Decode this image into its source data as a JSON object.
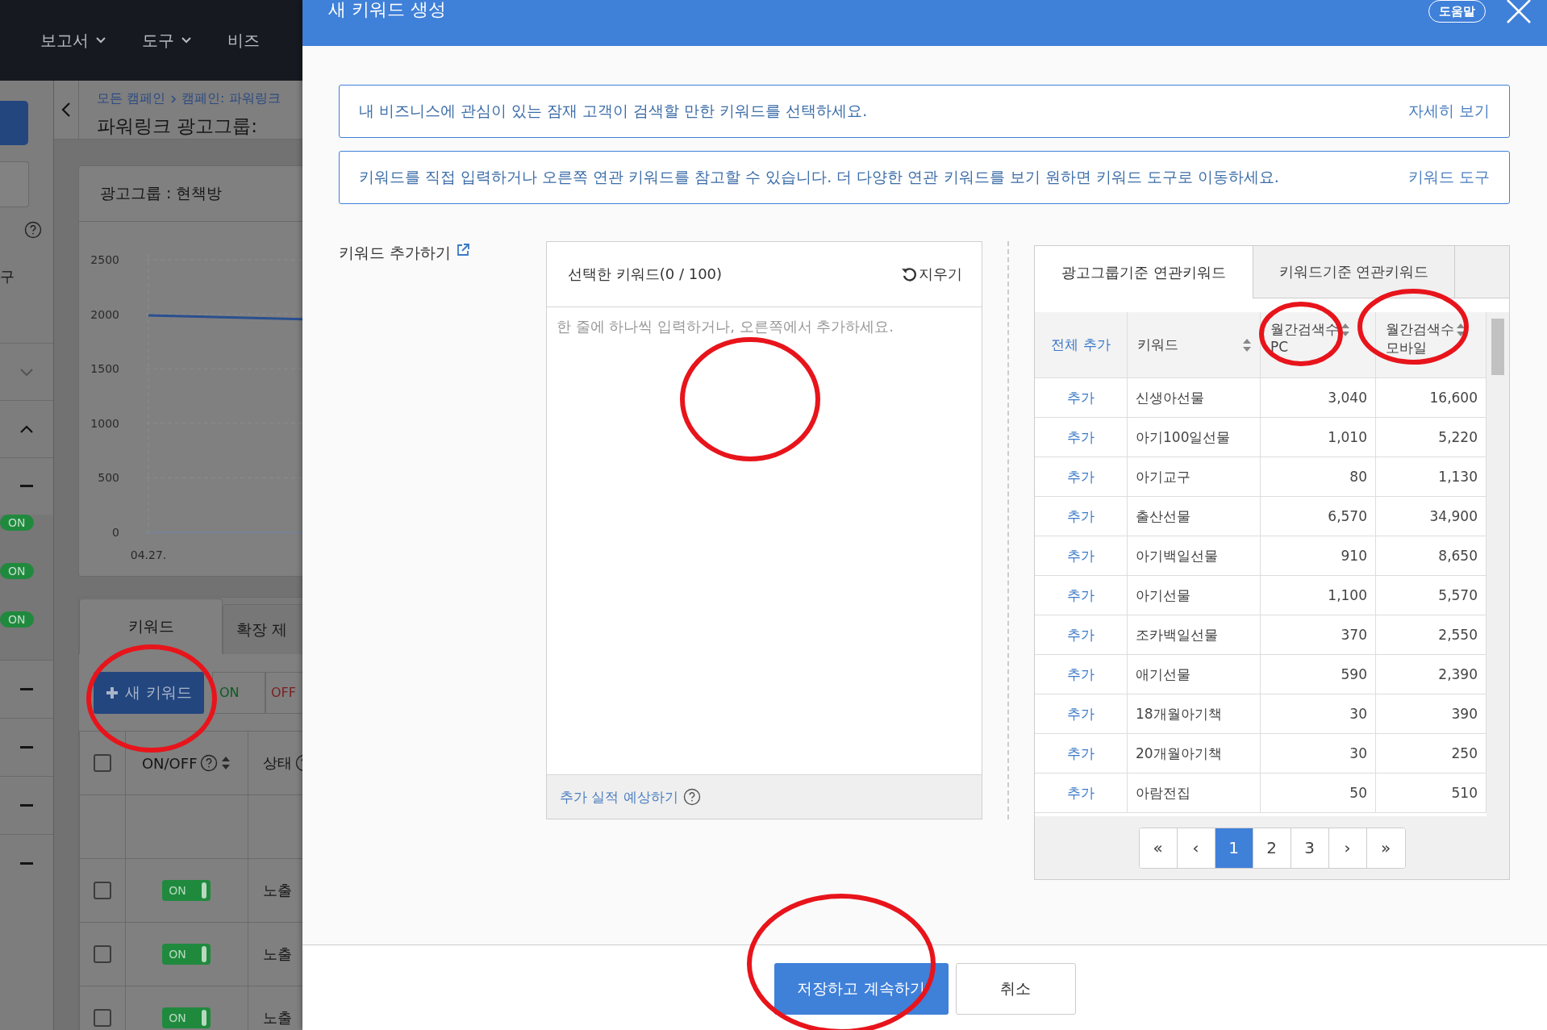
{
  "background": {
    "nav": [
      "보고서",
      "도구",
      "비즈"
    ],
    "sidebar": {
      "label": "구",
      "badges": [
        "ON",
        "ON",
        "ON"
      ]
    },
    "breadcrumb": [
      "모든 캠페인",
      "캠페인: 파워링크"
    ],
    "title": "파워링크 광고그룹:",
    "card": {
      "title": "광고그룹 : 현책방",
      "y_ticks": [
        "2500",
        "2000",
        "1500",
        "1000",
        "500",
        "0"
      ],
      "x_labels": [
        "04.27."
      ]
    },
    "tabs": [
      {
        "label": "키워드",
        "selected": true
      },
      {
        "label": "확장 제",
        "selected": false
      }
    ],
    "new_keyword_button": "새 키워드",
    "filter_buttons": [
      {
        "label": "ON",
        "color": "#0c5a22"
      },
      {
        "label": "OFF",
        "color": "#7a1e1e"
      }
    ],
    "table": {
      "columns": [
        "ON/OFF",
        "상태"
      ],
      "header_checked": false,
      "rows": [
        {
          "checked": false,
          "toggle": "ON",
          "on": true,
          "status": "노출"
        },
        {
          "checked": false,
          "toggle": "ON",
          "on": true,
          "status": "노출"
        },
        {
          "checked": false,
          "toggle": "ON",
          "on": true,
          "status": "노출"
        }
      ]
    }
  },
  "dialog": {
    "title": "새 키워드 생성",
    "help_button": "도움말",
    "notices": [
      {
        "text": "내 비즈니스에 관심이 있는 잠재 고객이 검색할 만한 키워드를 선택하세요.",
        "link": "자세히 보기"
      },
      {
        "text": "키워드를 직접 입력하거나 오른쪽 연관 키워드를 참고할 수 있습니다. 더 다양한 연관 키워드를 보기 원하면 키워드 도구로 이동하세요.",
        "link": "키워드 도구"
      }
    ],
    "add_keyword_label": "키워드 추가하기",
    "selected_panel": {
      "title": "선택한 키워드(0 / 100)",
      "clear_button": "지우기",
      "placeholder": "한 줄에 하나씩 입력하거나, 오른쪽에서 추가하세요.",
      "forecast_link": "추가 실적 예상하기"
    },
    "related": {
      "tabs": [
        {
          "label": "광고그룹기준 연관키워드",
          "selected": true
        },
        {
          "label": "키워드기준 연관키워드",
          "selected": false
        }
      ],
      "add_all": "전체 추가",
      "columns": [
        {
          "lines": [
            "키워드"
          ]
        },
        {
          "lines": [
            "월간검색수",
            "PC"
          ]
        },
        {
          "lines": [
            "월간검색수",
            "모바일"
          ]
        }
      ],
      "rows": [
        {
          "action": "추가",
          "keyword": "신생아선물",
          "pc": "3,040",
          "mobile": "16,600"
        },
        {
          "action": "추가",
          "keyword": "아기100일선물",
          "pc": "1,010",
          "mobile": "5,220"
        },
        {
          "action": "추가",
          "keyword": "아기교구",
          "pc": "80",
          "mobile": "1,130"
        },
        {
          "action": "추가",
          "keyword": "출산선물",
          "pc": "6,570",
          "mobile": "34,900"
        },
        {
          "action": "추가",
          "keyword": "아기백일선물",
          "pc": "910",
          "mobile": "8,650"
        },
        {
          "action": "추가",
          "keyword": "아기선물",
          "pc": "1,100",
          "mobile": "5,570"
        },
        {
          "action": "추가",
          "keyword": "조카백일선물",
          "pc": "370",
          "mobile": "2,550"
        },
        {
          "action": "추가",
          "keyword": "애기선물",
          "pc": "590",
          "mobile": "2,390"
        },
        {
          "action": "추가",
          "keyword": "18개월아기책",
          "pc": "30",
          "mobile": "390"
        },
        {
          "action": "추가",
          "keyword": "20개월아기책",
          "pc": "30",
          "mobile": "250"
        },
        {
          "action": "추가",
          "keyword": "아람전집",
          "pc": "50",
          "mobile": "510"
        }
      ],
      "pagination": {
        "first": "«",
        "prev": "‹",
        "pages": [
          {
            "label": "1",
            "selected": true
          },
          {
            "label": "2",
            "selected": false
          },
          {
            "label": "3",
            "selected": false
          }
        ],
        "next": "›",
        "last": "»"
      }
    },
    "buttons": [
      {
        "label": "저장하고 계속하기",
        "kind": "primary"
      },
      {
        "label": "취소",
        "kind": "secondary"
      }
    ]
  }
}
